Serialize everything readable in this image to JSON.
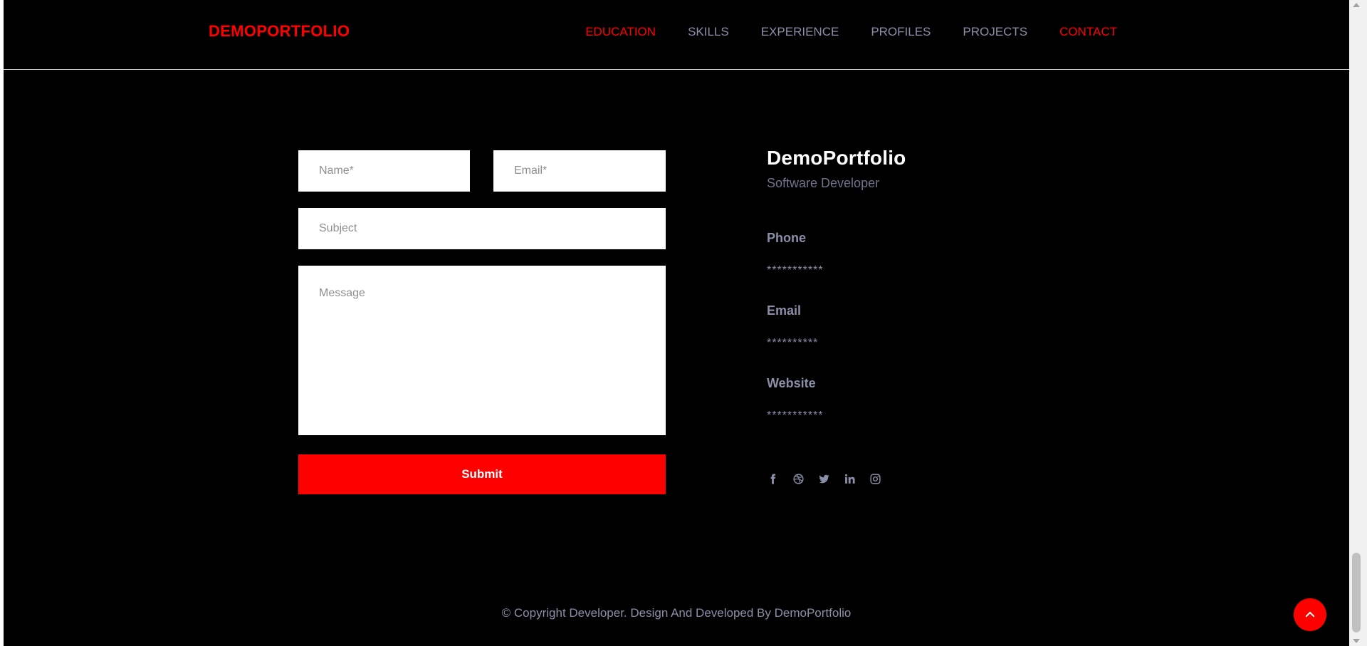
{
  "header": {
    "brand": "DEMOPORTFOLIO",
    "nav": [
      "EDUCATION",
      "SKILLS",
      "EXPERIENCE",
      "PROFILES",
      "PROJECTS",
      "CONTACT"
    ]
  },
  "form": {
    "name_placeholder": "Name*",
    "email_placeholder": "Email*",
    "subject_placeholder": "Subject",
    "message_placeholder": "Message",
    "submit_label": "Submit"
  },
  "info": {
    "name": "DemoPortfolio",
    "role": "Software Developer",
    "phone_label": "Phone",
    "phone_value": "***********",
    "email_label": "Email",
    "email_value": "**********",
    "website_label": "Website",
    "website_value": "***********"
  },
  "socials": [
    "facebook-icon",
    "dribbble-icon",
    "twitter-icon",
    "linkedin-icon",
    "instagram-icon"
  ],
  "footer": {
    "copyright": "© Copyright Developer. Design And Developed By DemoPortfolio"
  },
  "colors": {
    "background": "#000000",
    "accent": "#ff0000",
    "muted": "#8a8fa8",
    "white": "#ffffff"
  }
}
